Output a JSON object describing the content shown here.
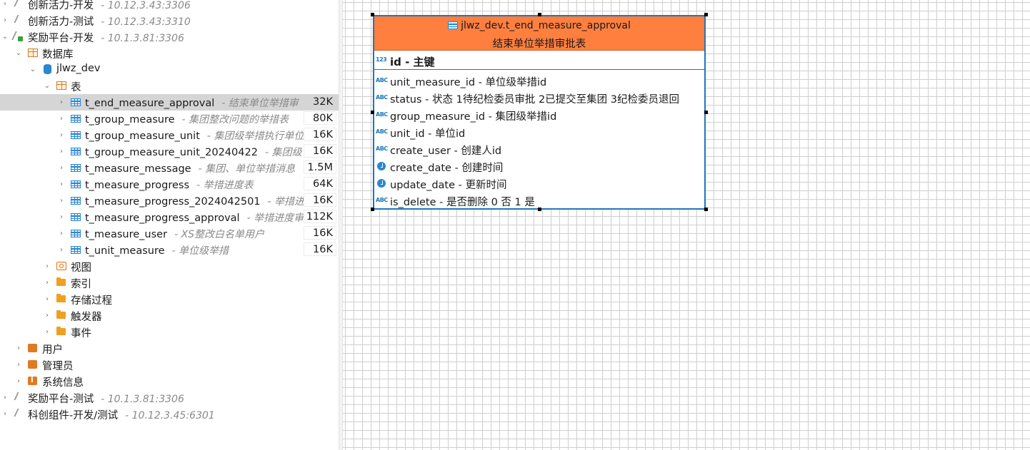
{
  "tree": {
    "rows": [
      {
        "label": "创新活力-开发",
        "sub": "- 10.12.3.43:3306"
      },
      {
        "label": "创新活力-测试",
        "sub": "- 10.12.3.43:3310"
      },
      {
        "label": "奖励平台-开发",
        "sub": "- 10.1.3.81:3306"
      },
      {
        "label": "数据库"
      },
      {
        "label": "jlwz_dev"
      },
      {
        "label": "表"
      },
      {
        "label": "t_end_measure_approval",
        "sub": "- 结束单位举措审",
        "size": "32K"
      },
      {
        "label": "t_group_measure",
        "sub": "- 集团整改问题的举措表",
        "size": "80K"
      },
      {
        "label": "t_group_measure_unit",
        "sub": "- 集团级举措执行单位",
        "size": "16K"
      },
      {
        "label": "t_group_measure_unit_20240422",
        "sub": "- 集团级",
        "size": "16K"
      },
      {
        "label": "t_measure_message",
        "sub": "- 集团、单位举措消息",
        "size": "1.5M"
      },
      {
        "label": "t_measure_progress",
        "sub": "- 举措进度表",
        "size": "64K"
      },
      {
        "label": "t_measure_progress_2024042501",
        "sub": "- 举措进",
        "size": "16K"
      },
      {
        "label": "t_measure_progress_approval",
        "sub": "- 举措进度审",
        "size": "112K"
      },
      {
        "label": "t_measure_user",
        "sub": "- XS整改白名单用户",
        "size": "16K"
      },
      {
        "label": "t_unit_measure",
        "sub": "- 单位级举措",
        "size": "16K"
      },
      {
        "label": "视图"
      },
      {
        "label": "索引"
      },
      {
        "label": "存储过程"
      },
      {
        "label": "触发器"
      },
      {
        "label": "事件"
      },
      {
        "label": "用户"
      },
      {
        "label": "管理员"
      },
      {
        "label": "系统信息"
      },
      {
        "label": "奖励平台-测试",
        "sub": "- 10.1.3.81:3306"
      },
      {
        "label": "科创组件-开发/测试",
        "sub": "- 10.12.3.45:6301"
      }
    ]
  },
  "entity": {
    "name": "jlwz_dev.t_end_measure_approval",
    "comment": "结束单位举措审批表",
    "primary_key": {
      "type": "123",
      "text": "id - 主键"
    },
    "attributes": [
      {
        "type": "ABC",
        "text": "unit_measure_id - 单位级举措id"
      },
      {
        "type": "ABC",
        "text": "status - 状态 1待纪检委员审批 2已提交至集团 3纪检委员退回"
      },
      {
        "type": "ABC",
        "text": "group_measure_id - 集团级举措id"
      },
      {
        "type": "ABC",
        "text": "unit_id - 单位id"
      },
      {
        "type": "ABC",
        "text": "create_user - 创建人id"
      },
      {
        "type": "clock",
        "text": "create_date - 创建时间"
      },
      {
        "type": "clock",
        "text": "update_date - 更新时间"
      },
      {
        "type": "ABC",
        "text": "is_delete - 是否删除 0 否 1 是"
      }
    ]
  },
  "colors": {
    "header": "#ff7f3f",
    "border": "#1d78b8",
    "selection": "#d5d5d5"
  }
}
